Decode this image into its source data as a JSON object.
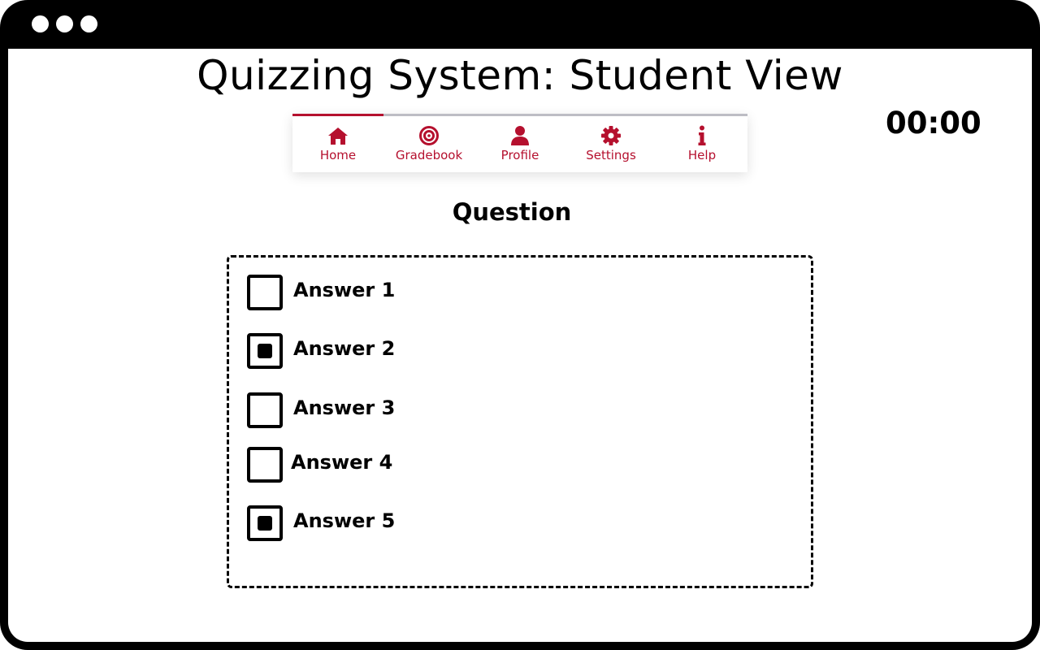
{
  "window": {
    "controls": [
      "window-dot",
      "window-dot",
      "window-dot"
    ]
  },
  "page_title": "Quizzing System: Student View",
  "timer": "00:00",
  "colors": {
    "accent": "#b5102e",
    "nav_track": "#bdbdc4",
    "frame": "#000000"
  },
  "nav": {
    "active_index": 0,
    "items": [
      {
        "label": "Home",
        "icon": "home-icon"
      },
      {
        "label": "Gradebook",
        "icon": "target-icon"
      },
      {
        "label": "Profile",
        "icon": "user-icon"
      },
      {
        "label": "Settings",
        "icon": "gear-icon"
      },
      {
        "label": "Help",
        "icon": "info-icon"
      }
    ]
  },
  "question": {
    "title": "Question",
    "answers": [
      {
        "label": "Answer 1",
        "checked": false
      },
      {
        "label": "Answer 2",
        "checked": true
      },
      {
        "label": "Answer 3",
        "checked": false
      },
      {
        "label": "Answer 4",
        "checked": false
      },
      {
        "label": "Answer 5",
        "checked": true
      }
    ]
  }
}
